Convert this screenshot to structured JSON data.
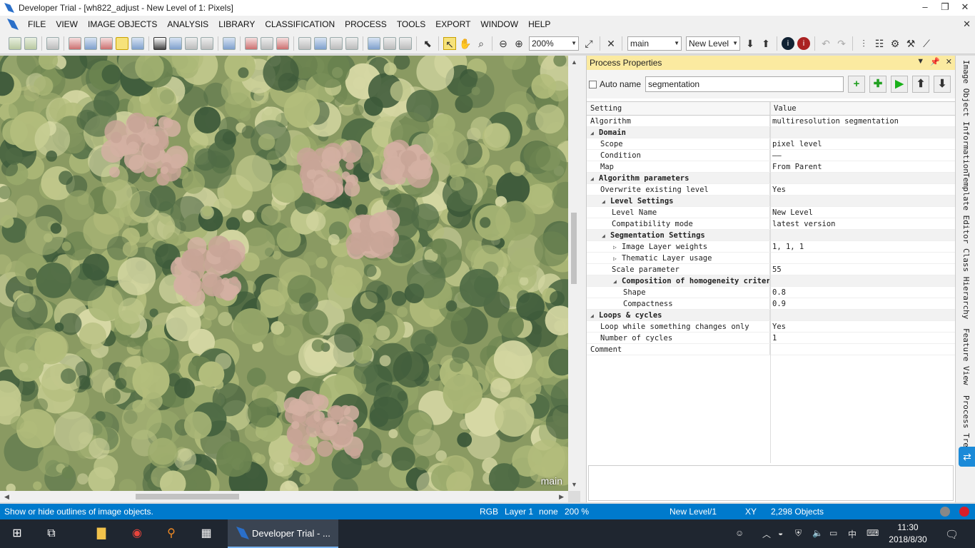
{
  "window": {
    "title": "Developer Trial - [wh822_adjust - New Level of 1: Pixels]",
    "controls": [
      "–",
      "❐",
      "✕"
    ]
  },
  "menu": {
    "items": [
      "FILE",
      "VIEW",
      "IMAGE OBJECTS",
      "ANALYSIS",
      "LIBRARY",
      "CLASSIFICATION",
      "PROCESS",
      "TOOLS",
      "EXPORT",
      "WINDOW",
      "HELP"
    ],
    "close": "✕"
  },
  "toolbar": {
    "zoom": "200%",
    "map_select": "main",
    "level_select": "New Level"
  },
  "viewer": {
    "map_label": "main",
    "accent_colors": {
      "canopy_light": "#b9c07e",
      "canopy_dark": "#3d5a3a",
      "dead_pink": "#d4b0a2"
    }
  },
  "process_panel": {
    "title": "Process Properties",
    "auto_name_label": "Auto name",
    "name_value": "segmentation",
    "auto_name_checked": false,
    "buttons": [
      "add-process",
      "add-child-process",
      "execute",
      "move-up",
      "move-down"
    ],
    "columns": [
      "Setting",
      "Value"
    ],
    "rows": [
      {
        "setting": "Algorithm",
        "value": "multiresolution segmentation",
        "indent": 0,
        "group": false,
        "marker": ""
      },
      {
        "setting": "Domain",
        "value": "",
        "indent": 0,
        "group": true,
        "marker": "◢"
      },
      {
        "setting": "Scope",
        "value": "pixel level",
        "indent": 1,
        "group": false,
        "marker": ""
      },
      {
        "setting": "Condition",
        "value": "——",
        "indent": 1,
        "group": false,
        "marker": ""
      },
      {
        "setting": "Map",
        "value": "From Parent",
        "indent": 1,
        "group": false,
        "marker": ""
      },
      {
        "setting": "Algorithm parameters",
        "value": "",
        "indent": 0,
        "group": true,
        "marker": "◢"
      },
      {
        "setting": "Overwrite existing level",
        "value": "Yes",
        "indent": 1,
        "group": false,
        "marker": ""
      },
      {
        "setting": "Level Settings",
        "value": "",
        "indent": 1,
        "group": true,
        "marker": "◢"
      },
      {
        "setting": "Level Name",
        "value": "New Level",
        "indent": 2,
        "group": false,
        "marker": ""
      },
      {
        "setting": "Compatibility mode",
        "value": "latest version",
        "indent": 2,
        "group": false,
        "marker": ""
      },
      {
        "setting": "Segmentation Settings",
        "value": "",
        "indent": 1,
        "group": true,
        "marker": "◢"
      },
      {
        "setting": "Image Layer weights",
        "value": "1, 1, 1",
        "indent": 2,
        "group": false,
        "marker": "▷"
      },
      {
        "setting": "Thematic Layer usage",
        "value": "",
        "indent": 2,
        "group": false,
        "marker": "▷"
      },
      {
        "setting": "Scale parameter",
        "value": "55",
        "indent": 2,
        "group": false,
        "marker": ""
      },
      {
        "setting": "Composition of homogeneity criterion",
        "value": "",
        "indent": 2,
        "group": true,
        "marker": "◢"
      },
      {
        "setting": "Shape",
        "value": "0.8",
        "indent": 3,
        "group": false,
        "marker": ""
      },
      {
        "setting": "Compactness",
        "value": "0.9",
        "indent": 3,
        "group": false,
        "marker": ""
      },
      {
        "setting": "Loops & cycles",
        "value": "",
        "indent": 0,
        "group": true,
        "marker": "◢"
      },
      {
        "setting": "Loop while something changes only",
        "value": "Yes",
        "indent": 1,
        "group": false,
        "marker": ""
      },
      {
        "setting": "Number of cycles",
        "value": "1",
        "indent": 1,
        "group": false,
        "marker": ""
      },
      {
        "setting": "Comment",
        "value": "",
        "indent": -1,
        "group": false,
        "marker": ""
      }
    ]
  },
  "side_tabs": [
    "Image Object Information",
    "Template Editor",
    "Class Hierarchy",
    "Feature View",
    "Process Tree"
  ],
  "status": {
    "hint": "Show or hide outlines of image objects.",
    "mode": "RGB",
    "layer": "Layer 1",
    "none": "none",
    "zoom": "200 %",
    "level": "New Level/1",
    "xy": "XY",
    "objects": "2,298 Objects"
  },
  "taskbar": {
    "app_label": "Developer Trial - ...",
    "time": "11:30",
    "date": "2018/8/30",
    "ime": "中"
  }
}
